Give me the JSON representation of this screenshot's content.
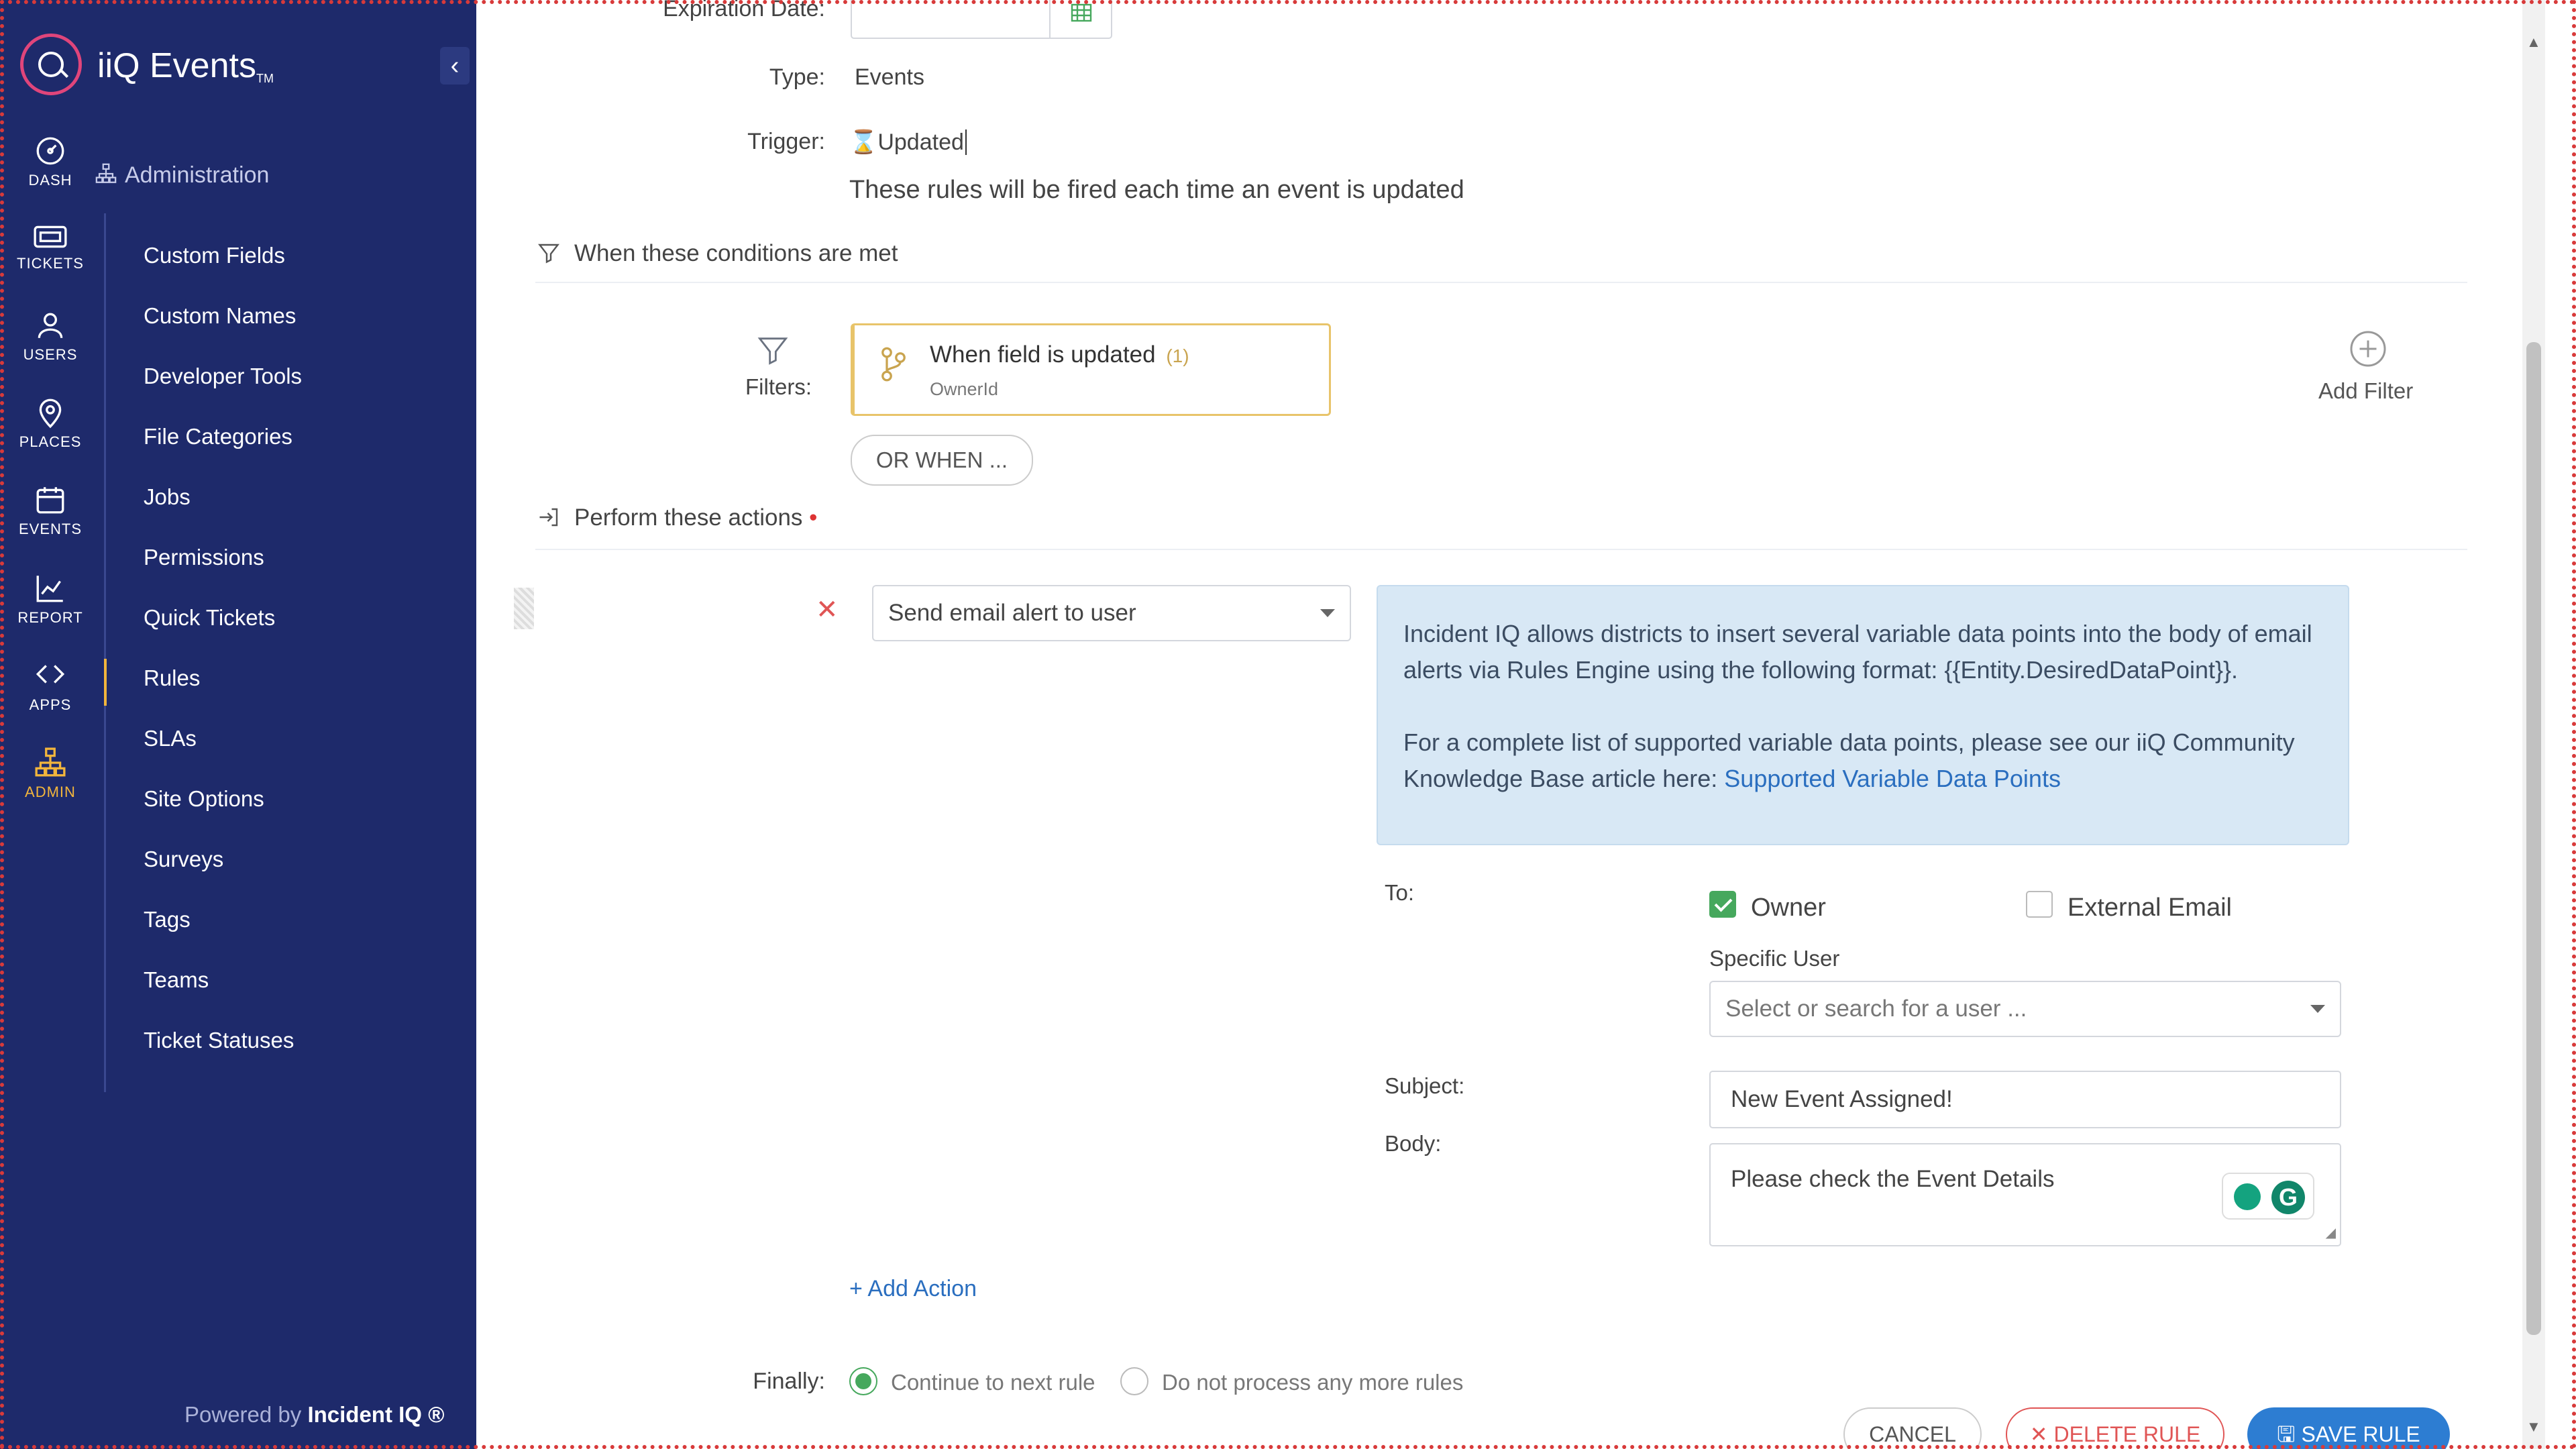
{
  "app": {
    "title": "iiQ Events",
    "tm": "TM",
    "powered_prefix": "Powered by",
    "powered_brand": "Incident IQ ®"
  },
  "rail": [
    {
      "label": "DASH",
      "icon": "dashboard-icon"
    },
    {
      "label": "TICKETS",
      "icon": "ticket-icon"
    },
    {
      "label": "USERS",
      "icon": "user-icon"
    },
    {
      "label": "PLACES",
      "icon": "map-pin-icon"
    },
    {
      "label": "EVENTS",
      "icon": "calendar-icon"
    },
    {
      "label": "REPORT",
      "icon": "chart-icon"
    },
    {
      "label": "APPS",
      "icon": "apps-icon"
    },
    {
      "label": "ADMIN",
      "icon": "org-chart-icon"
    }
  ],
  "admin": {
    "heading": "Administration",
    "items": [
      "Custom Fields",
      "Custom Names",
      "Developer Tools",
      "File Categories",
      "Jobs",
      "Permissions",
      "Quick Tickets",
      "Rules",
      "SLAs",
      "Site Options",
      "Surveys",
      "Tags",
      "Teams",
      "Ticket Statuses"
    ],
    "active": "Rules"
  },
  "form": {
    "expiration_label": "Expiration Date:",
    "type_label": "Type:",
    "type_value": "Events",
    "trigger_label": "Trigger:",
    "trigger_value": "Updated",
    "trigger_desc": "These rules will be fired each time an event is updated",
    "conditions_title": "When these conditions are met",
    "filters_label": "Filters:",
    "filter_card": {
      "title": "When field is updated",
      "count": "(1)",
      "field": "OwnerId"
    },
    "or_when": "OR WHEN ...",
    "add_filter": "Add Filter",
    "actions_title": "Perform these actions",
    "required_mark": "•",
    "action_select": "Send email alert to user",
    "info_line1": "Incident IQ allows districts to insert several variable data points into the body of email alerts via Rules Engine using the following format: {{Entity.DesiredDataPoint}}.",
    "info_line2": "For a complete list of supported variable data points, please see our iiQ Community Knowledge Base article here:",
    "info_link": "Supported Variable Data Points",
    "to_label": "To:",
    "owner_label": "Owner",
    "owner_checked": true,
    "external_label": "External Email",
    "external_checked": false,
    "specific_user_label": "Specific User",
    "specific_user_placeholder": "Select or search for a user ...",
    "subject_label": "Subject:",
    "subject_value": "New Event Assigned!",
    "body_label": "Body:",
    "body_value": "Please check the Event Details",
    "add_action": "+ Add Action",
    "finally_label": "Finally:",
    "finally_options": [
      "Continue to next rule",
      "Do not process any more rules"
    ],
    "finally_selected": "Continue to next rule"
  },
  "buttons": {
    "cancel": "CANCEL",
    "delete": "DELETE RULE",
    "save": "SAVE RULE"
  },
  "colors": {
    "sidebar": "#1e2a6b",
    "accent": "#f2b53c",
    "logo": "#e0457b",
    "success": "#46a85d",
    "danger": "#e05555",
    "primary": "#2d7dd2"
  }
}
